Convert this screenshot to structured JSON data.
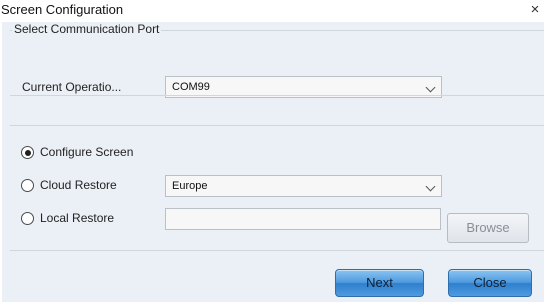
{
  "window": {
    "title": "Screen Configuration",
    "close_glyph": "×"
  },
  "port_group": {
    "legend": "Select Communication Port",
    "current_operation_label": "Current Operatio...",
    "current_port": "COM99"
  },
  "options": {
    "configure_screen": {
      "label": "Configure Screen",
      "selected": true
    },
    "cloud_restore": {
      "label": "Cloud Restore",
      "selected": false,
      "region": "Europe"
    },
    "local_restore": {
      "label": "Local Restore",
      "selected": false,
      "path": ""
    }
  },
  "buttons": {
    "browse": "Browse",
    "next": "Next",
    "close": "Close"
  },
  "colors": {
    "client_bg": "#ebf0f6",
    "button_blue": "#4d9ae0"
  }
}
